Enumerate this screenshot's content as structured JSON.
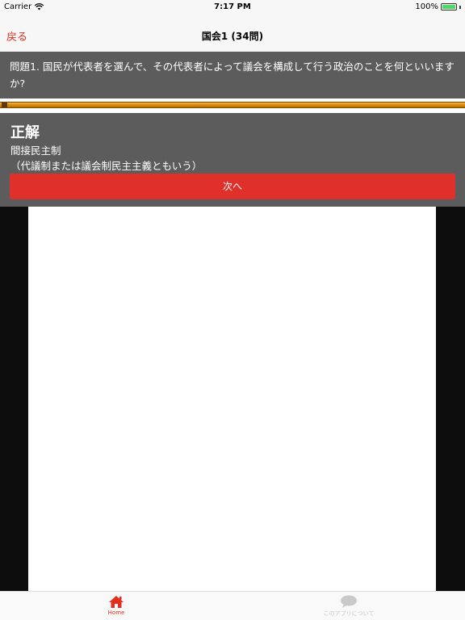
{
  "status_bar": {
    "carrier": "Carrier",
    "time": "7:17 PM",
    "battery": "100%",
    "wifi_icon": "wifi-icon",
    "battery_icon": "battery-icon"
  },
  "nav": {
    "back_label": "戻る",
    "title": "国会1 (34問)"
  },
  "question": {
    "text": "問題1. 国民が代表者を選んで、その代表者によって議会を構成して行う政治のことを何といいますか?"
  },
  "answer": {
    "heading": "正解",
    "text": "間接民主制",
    "note": "（代議制または議会制民主主義ともいう）"
  },
  "next_button": {
    "label": "次へ"
  },
  "tab_bar": {
    "tabs": [
      {
        "label": "Home",
        "icon": "home-icon",
        "active": true
      },
      {
        "label": "このアプリについて",
        "icon": "speech-bubble-icon",
        "active": false
      }
    ]
  },
  "colors": {
    "accent": "#e1301f",
    "overlay": "#5c5c5c",
    "timer": "#d6880c"
  }
}
